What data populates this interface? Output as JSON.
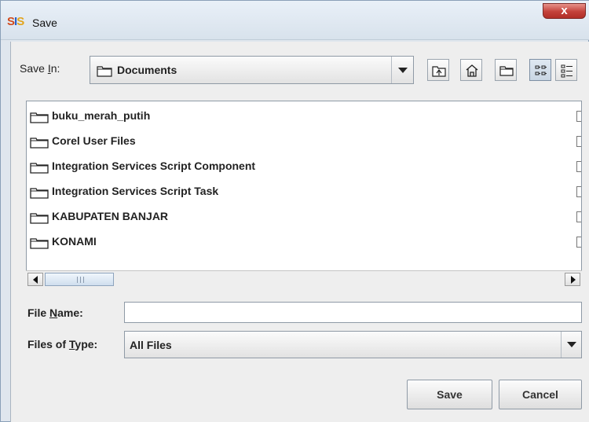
{
  "window": {
    "app_icon_letters": [
      "S",
      "I",
      "S"
    ],
    "title": "Save",
    "close_label": "x"
  },
  "save_in": {
    "label_prefix": "Save ",
    "label_mnemonic": "I",
    "label_suffix": "n:",
    "value": "Documents"
  },
  "toolbar": {
    "icons": [
      "up-folder-icon",
      "home-icon",
      "new-folder-icon",
      "list-view-icon",
      "details-view-icon"
    ],
    "active": "list-view-icon"
  },
  "files": [
    {
      "name": "buku_merah_putih",
      "icon": "folder-icon"
    },
    {
      "name": "Corel User Files",
      "icon": "folder-icon"
    },
    {
      "name": "Integration Services Script Component",
      "icon": "folder-icon"
    },
    {
      "name": "Integration Services Script Task",
      "icon": "folder-icon"
    },
    {
      "name": "KABUPATEN BANJAR",
      "icon": "folder-icon"
    },
    {
      "name": "KONAMI",
      "icon": "folder-icon"
    }
  ],
  "file_name": {
    "label_prefix": "File ",
    "label_mnemonic": "N",
    "label_suffix": "ame:",
    "value": ""
  },
  "file_type": {
    "label_prefix": "Files of ",
    "label_mnemonic": "T",
    "label_suffix": "ype:",
    "value": "All Files"
  },
  "buttons": {
    "save": "Save",
    "cancel": "Cancel"
  },
  "colors": {
    "title_bar": "#dfe6ee",
    "close_button": "#c3413a",
    "dialog_bg": "#eeeeee"
  }
}
